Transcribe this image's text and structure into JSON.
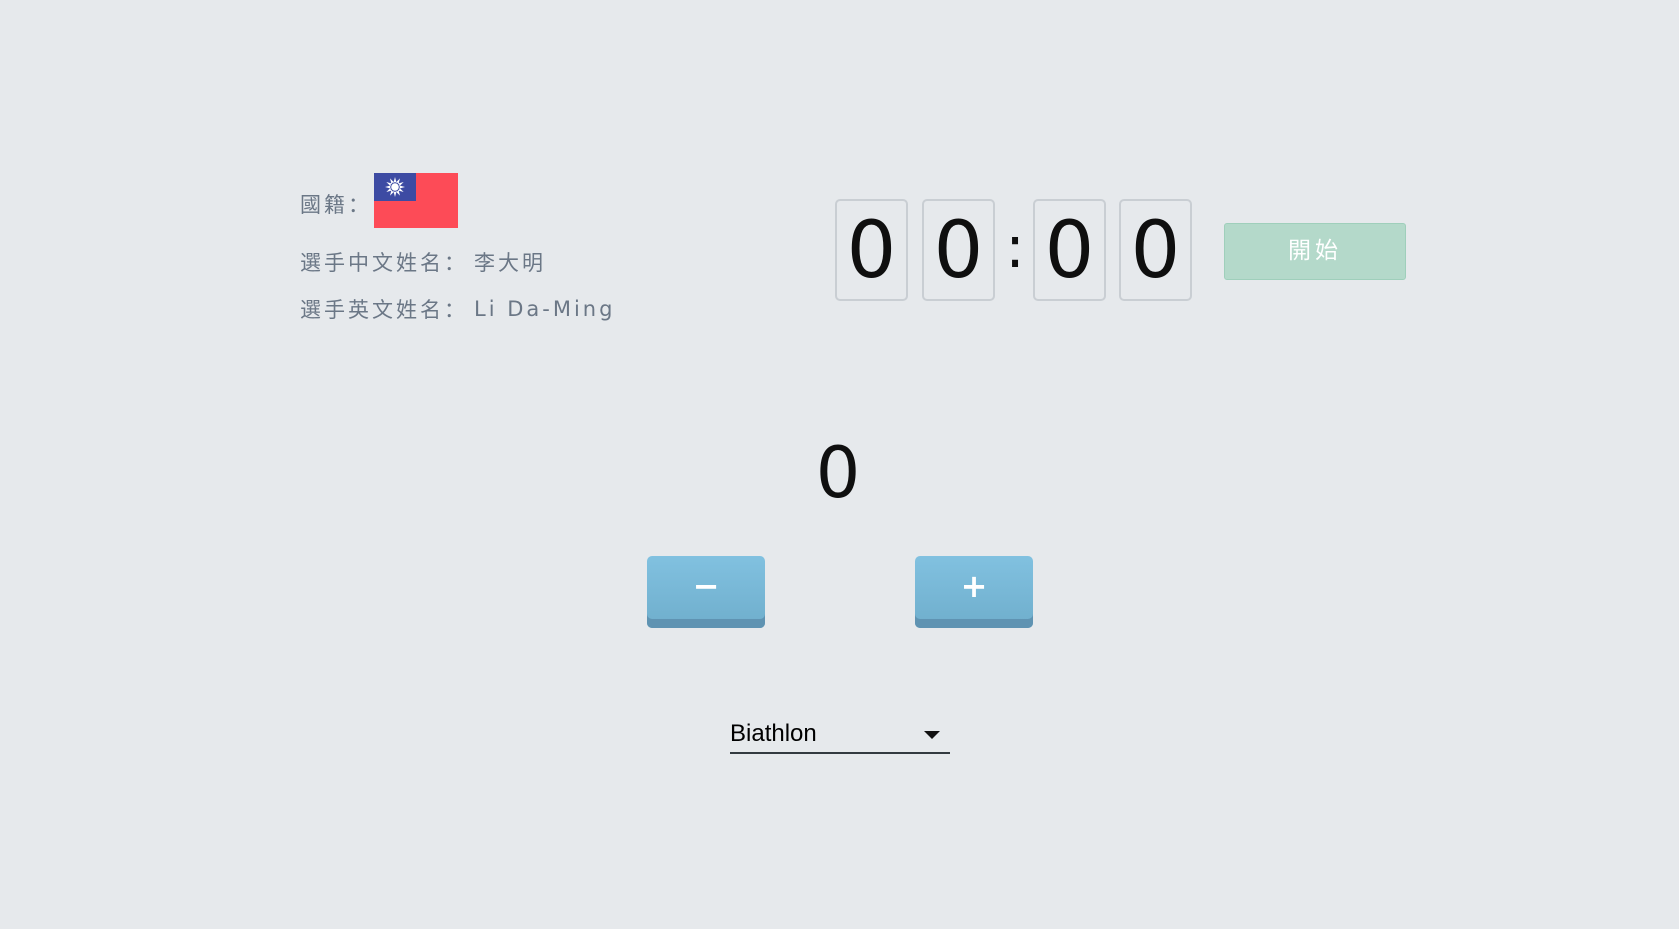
{
  "athlete": {
    "nationality_label": "國籍：",
    "flag": "taiwan-flag",
    "chinese_name_label": "選手中文姓名：",
    "chinese_name": "李大明",
    "english_name_label": "選手英文姓名：",
    "english_name": "Li Da-Ming"
  },
  "timer": {
    "digits": [
      "0",
      "0",
      "0",
      "0"
    ],
    "separator": ":",
    "start_label": "開始"
  },
  "counter": {
    "value": "0",
    "minus_label": "−",
    "plus_label": "+"
  },
  "sport_select": {
    "selected": "Biathlon"
  },
  "colors": {
    "background": "#e6e9ec",
    "start_button": "#b4d9ca",
    "counter_button": "#7bbad9",
    "flag_red": "#fd4b57",
    "flag_blue": "#3d4ba3"
  }
}
